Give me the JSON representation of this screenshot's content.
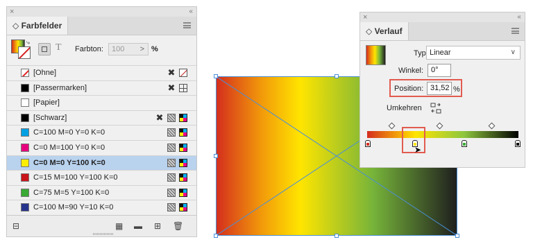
{
  "swatches_panel": {
    "close": "×",
    "collapse": "‹‹",
    "tab_label": "◇ Farbfelder",
    "tint_label": "Farbton:",
    "tint_value": "100",
    "tint_arrow": ">",
    "percent": "%",
    "type_glyph": "T",
    "swatches": [
      {
        "name": "[Ohne]",
        "color": "#ffffff",
        "kind": "none",
        "icons": [
          "scissors-x",
          "none-box"
        ]
      },
      {
        "name": "[Passermarken]",
        "color": "#000000",
        "kind": "solid",
        "icons": [
          "scissors-x",
          "registration"
        ]
      },
      {
        "name": "[Papier]",
        "color": "#ffffff",
        "kind": "solid",
        "icons": []
      },
      {
        "name": "[Schwarz]",
        "color": "#000000",
        "kind": "solid",
        "icons": [
          "scissors-x",
          "process",
          "cmyk"
        ]
      },
      {
        "name": "C=100 M=0 Y=0 K=0",
        "color": "#00a0e3",
        "kind": "solid",
        "icons": [
          "process",
          "cmyk"
        ]
      },
      {
        "name": "C=0 M=100 Y=0 K=0",
        "color": "#e6007e",
        "kind": "solid",
        "icons": [
          "process",
          "cmyk"
        ]
      },
      {
        "name": "C=0 M=0 Y=100 K=0",
        "color": "#ffed00",
        "kind": "solid",
        "icons": [
          "process",
          "cmyk"
        ],
        "selected": true
      },
      {
        "name": "C=15 M=100 Y=100 K=0",
        "color": "#c8151b",
        "kind": "solid",
        "icons": [
          "process",
          "cmyk"
        ]
      },
      {
        "name": "C=75 M=5 Y=100 K=0",
        "color": "#3aa935",
        "kind": "solid",
        "icons": [
          "process",
          "cmyk"
        ]
      },
      {
        "name": "C=100 M=90 Y=10 K=0",
        "color": "#27348b",
        "kind": "solid",
        "icons": [
          "process",
          "cmyk"
        ]
      }
    ]
  },
  "gradient_panel": {
    "close": "×",
    "collapse": "‹‹",
    "tab_label": "◇ Verlauf",
    "type_label": "Typ:",
    "type_value": "Linear",
    "angle_label": "Winkel:",
    "angle_value": "0°",
    "position_label": "Position:",
    "position_value": "31,52",
    "position_unit": "%",
    "reverse_label": "Umkehren"
  },
  "colors": {
    "selection_row": "#b9d2ee",
    "highlight": "#e25b4f",
    "frame_handle": "#4a8fd8"
  }
}
